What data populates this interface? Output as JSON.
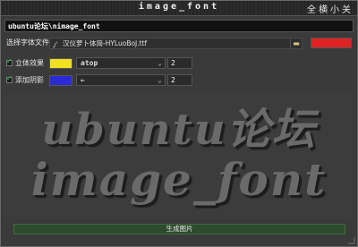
{
  "window": {
    "title": "image_font",
    "controls": [
      "全",
      "横",
      "小",
      "关"
    ]
  },
  "text_input": {
    "value": "ubuntu论坛\\nimage_font"
  },
  "font_row": {
    "label": "选择字体文件",
    "font_path": "汉仪萝卜体简-HYLuoBoJ.ttf",
    "font_icon": "font-file-icon",
    "folder_icon": "folder-icon",
    "text_color": "#e02222"
  },
  "effect_row": {
    "checked": true,
    "label": "立体效果",
    "color": "#f0e020",
    "direction": "atop",
    "depth": "2"
  },
  "shadow_row": {
    "checked": true,
    "label": "添加阴影",
    "color": "#2a2ad8",
    "direction": "←",
    "depth": "2"
  },
  "preview": {
    "line1": "ubuntu论坛",
    "line2": "image_font"
  },
  "generate_button": {
    "label": "生成图片"
  }
}
